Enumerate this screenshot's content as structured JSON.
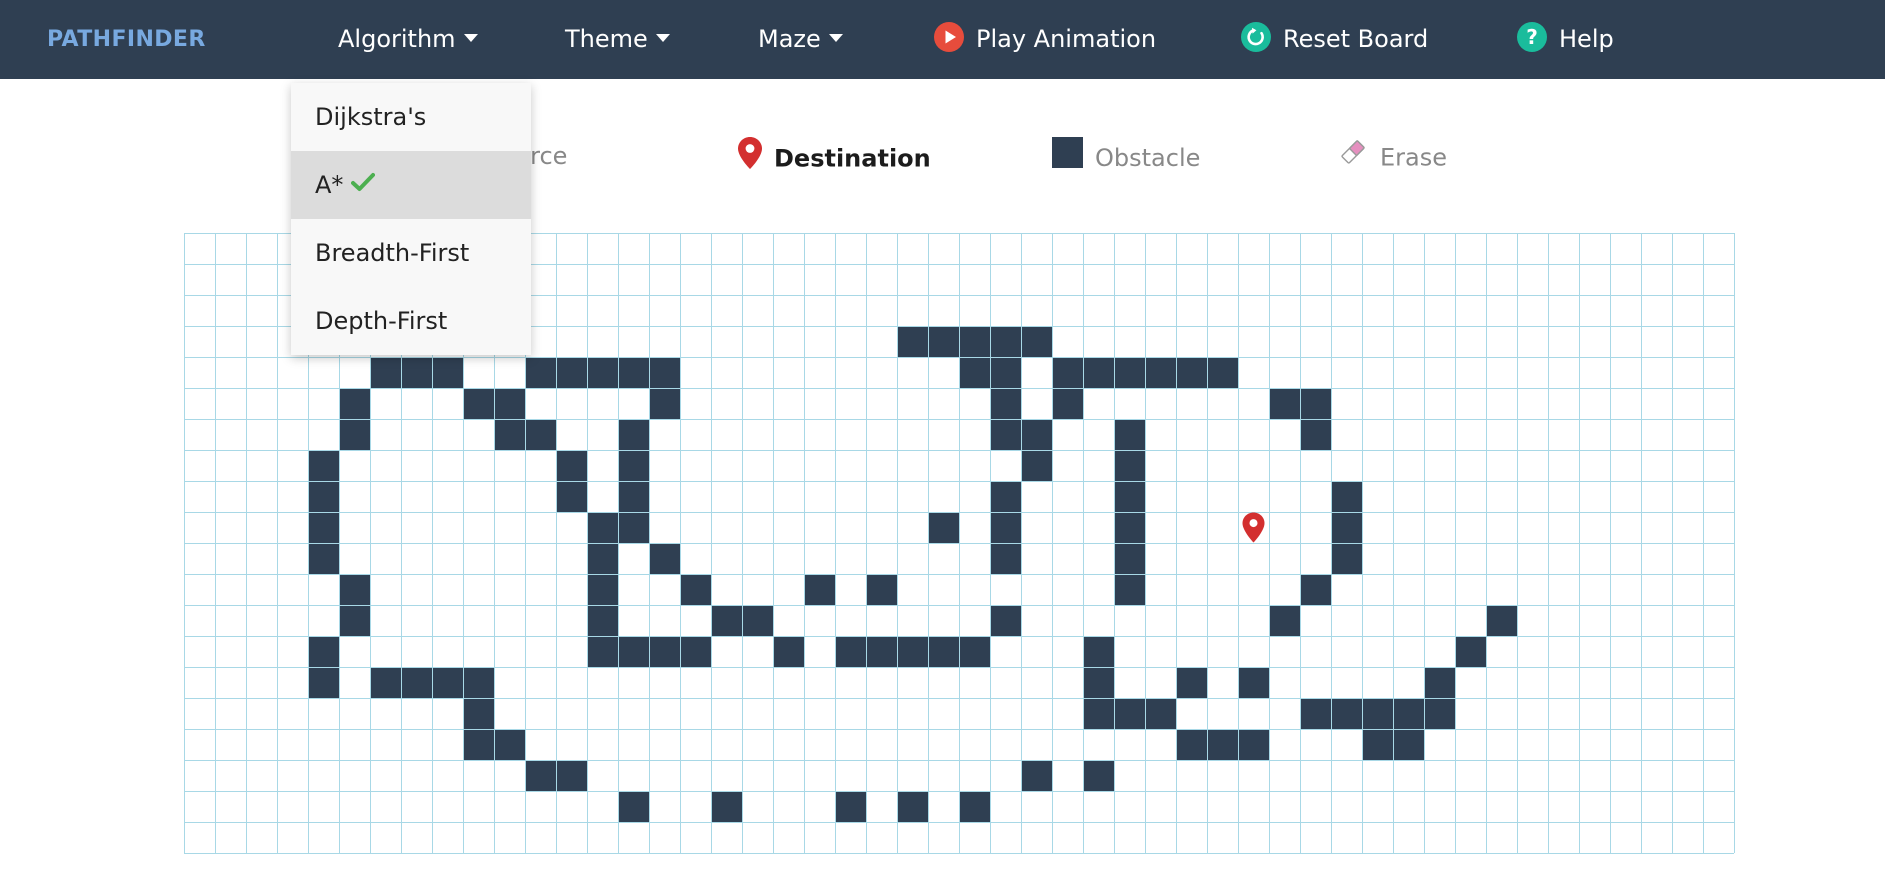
{
  "navbar": {
    "brand": "PATHFINDER",
    "algorithm_label": "Algorithm",
    "theme_label": "Theme",
    "maze_label": "Maze",
    "play_label": "Play Animation",
    "reset_label": "Reset Board",
    "help_label": "Help",
    "colors": {
      "background": "#2f3f52",
      "brand": "#78a9e0",
      "play": "#e74c3c",
      "reset": "#1abc9c",
      "help": "#1abc9c"
    }
  },
  "algorithm_menu": {
    "items": [
      {
        "label": "Dijkstra's",
        "selected": false
      },
      {
        "label": "A*",
        "selected": true
      },
      {
        "label": "Breadth-First",
        "selected": false
      },
      {
        "label": "Depth-First",
        "selected": false
      }
    ],
    "check_icon": "check-icon",
    "check_color": "#4caf50"
  },
  "legend": {
    "source_label": "Source",
    "destination_label": "Destination",
    "obstacle_label": "Obstacle",
    "erase_label": "Erase",
    "destination_color": "#d32f2f",
    "obstacle_color": "#2f3f52",
    "erase_color": "#e58fbf"
  },
  "grid": {
    "cols": 50,
    "rows": 20,
    "line_color": "#a8d8e6",
    "wall_color": "#2f3f52",
    "destination": [
      34,
      9
    ],
    "walls": [
      [
        23,
        3
      ],
      [
        24,
        3
      ],
      [
        25,
        3
      ],
      [
        26,
        3
      ],
      [
        27,
        3
      ],
      [
        6,
        4
      ],
      [
        7,
        4
      ],
      [
        8,
        4
      ],
      [
        11,
        4
      ],
      [
        12,
        4
      ],
      [
        13,
        4
      ],
      [
        14,
        4
      ],
      [
        15,
        4
      ],
      [
        25,
        4
      ],
      [
        26,
        4
      ],
      [
        28,
        4
      ],
      [
        29,
        4
      ],
      [
        30,
        4
      ],
      [
        31,
        4
      ],
      [
        32,
        4
      ],
      [
        33,
        4
      ],
      [
        5,
        5
      ],
      [
        9,
        5
      ],
      [
        10,
        5
      ],
      [
        15,
        5
      ],
      [
        26,
        5
      ],
      [
        28,
        5
      ],
      [
        35,
        5
      ],
      [
        36,
        5
      ],
      [
        5,
        6
      ],
      [
        10,
        6
      ],
      [
        11,
        6
      ],
      [
        14,
        6
      ],
      [
        26,
        6
      ],
      [
        27,
        6
      ],
      [
        30,
        6
      ],
      [
        36,
        6
      ],
      [
        4,
        7
      ],
      [
        12,
        7
      ],
      [
        14,
        7
      ],
      [
        27,
        7
      ],
      [
        30,
        7
      ],
      [
        4,
        8
      ],
      [
        12,
        8
      ],
      [
        14,
        8
      ],
      [
        26,
        8
      ],
      [
        30,
        8
      ],
      [
        37,
        8
      ],
      [
        4,
        9
      ],
      [
        13,
        9
      ],
      [
        14,
        9
      ],
      [
        24,
        9
      ],
      [
        26,
        9
      ],
      [
        30,
        9
      ],
      [
        37,
        9
      ],
      [
        4,
        10
      ],
      [
        13,
        10
      ],
      [
        15,
        10
      ],
      [
        26,
        10
      ],
      [
        30,
        10
      ],
      [
        37,
        10
      ],
      [
        5,
        11
      ],
      [
        13,
        11
      ],
      [
        16,
        11
      ],
      [
        20,
        11
      ],
      [
        22,
        11
      ],
      [
        30,
        11
      ],
      [
        36,
        11
      ],
      [
        5,
        12
      ],
      [
        13,
        12
      ],
      [
        17,
        12
      ],
      [
        18,
        12
      ],
      [
        26,
        12
      ],
      [
        35,
        12
      ],
      [
        42,
        12
      ],
      [
        4,
        13
      ],
      [
        13,
        13
      ],
      [
        14,
        13
      ],
      [
        15,
        13
      ],
      [
        16,
        13
      ],
      [
        19,
        13
      ],
      [
        21,
        13
      ],
      [
        22,
        13
      ],
      [
        23,
        13
      ],
      [
        24,
        13
      ],
      [
        25,
        13
      ],
      [
        29,
        13
      ],
      [
        41,
        13
      ],
      [
        4,
        14
      ],
      [
        6,
        14
      ],
      [
        7,
        14
      ],
      [
        8,
        14
      ],
      [
        9,
        14
      ],
      [
        29,
        14
      ],
      [
        32,
        14
      ],
      [
        34,
        14
      ],
      [
        40,
        14
      ],
      [
        9,
        15
      ],
      [
        29,
        15
      ],
      [
        30,
        15
      ],
      [
        31,
        15
      ],
      [
        36,
        15
      ],
      [
        37,
        15
      ],
      [
        38,
        15
      ],
      [
        39,
        15
      ],
      [
        40,
        15
      ],
      [
        9,
        16
      ],
      [
        10,
        16
      ],
      [
        32,
        16
      ],
      [
        33,
        16
      ],
      [
        34,
        16
      ],
      [
        38,
        16
      ],
      [
        39,
        16
      ],
      [
        11,
        17
      ],
      [
        12,
        17
      ],
      [
        27,
        17
      ],
      [
        29,
        17
      ],
      [
        14,
        18
      ],
      [
        17,
        18
      ],
      [
        21,
        18
      ],
      [
        23,
        18
      ],
      [
        25,
        18
      ]
    ]
  }
}
